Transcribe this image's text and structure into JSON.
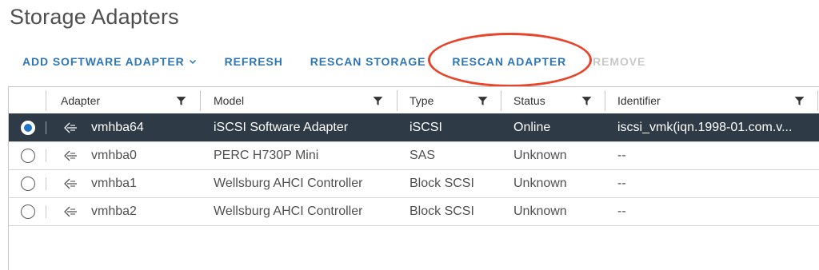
{
  "page": {
    "title": "Storage Adapters"
  },
  "toolbar": {
    "add_software_adapter": "ADD SOFTWARE ADAPTER",
    "refresh": "REFRESH",
    "rescan_storage": "RESCAN STORAGE",
    "rescan_adapter": "RESCAN ADAPTER",
    "remove": "REMOVE"
  },
  "table": {
    "columns": [
      "Adapter",
      "Model",
      "Type",
      "Status",
      "Identifier"
    ],
    "rows": [
      {
        "adapter": "vmhba64",
        "model": "iSCSI Software Adapter",
        "type": "iSCSI",
        "status": "Online",
        "identifier": "iscsi_vmk(iqn.1998-01.com.v...",
        "selected": true
      },
      {
        "adapter": "vmhba0",
        "model": "PERC H730P Mini",
        "type": "SAS",
        "status": "Unknown",
        "identifier": "--",
        "selected": false
      },
      {
        "adapter": "vmhba1",
        "model": "Wellsburg AHCI Controller",
        "type": "Block SCSI",
        "status": "Unknown",
        "identifier": "--",
        "selected": false
      },
      {
        "adapter": "vmhba2",
        "model": "Wellsburg AHCI Controller",
        "type": "Block SCSI",
        "status": "Unknown",
        "identifier": "--",
        "selected": false
      }
    ]
  },
  "icons": {
    "caret": "chevron-down-icon",
    "filter": "filter-icon",
    "adapter": "storage-adapter-icon"
  },
  "colors": {
    "accent": "#2f76b5",
    "selected_row": "#2e3a46",
    "highlight": "#e8462c",
    "radio_selected": "#1f74c7"
  }
}
